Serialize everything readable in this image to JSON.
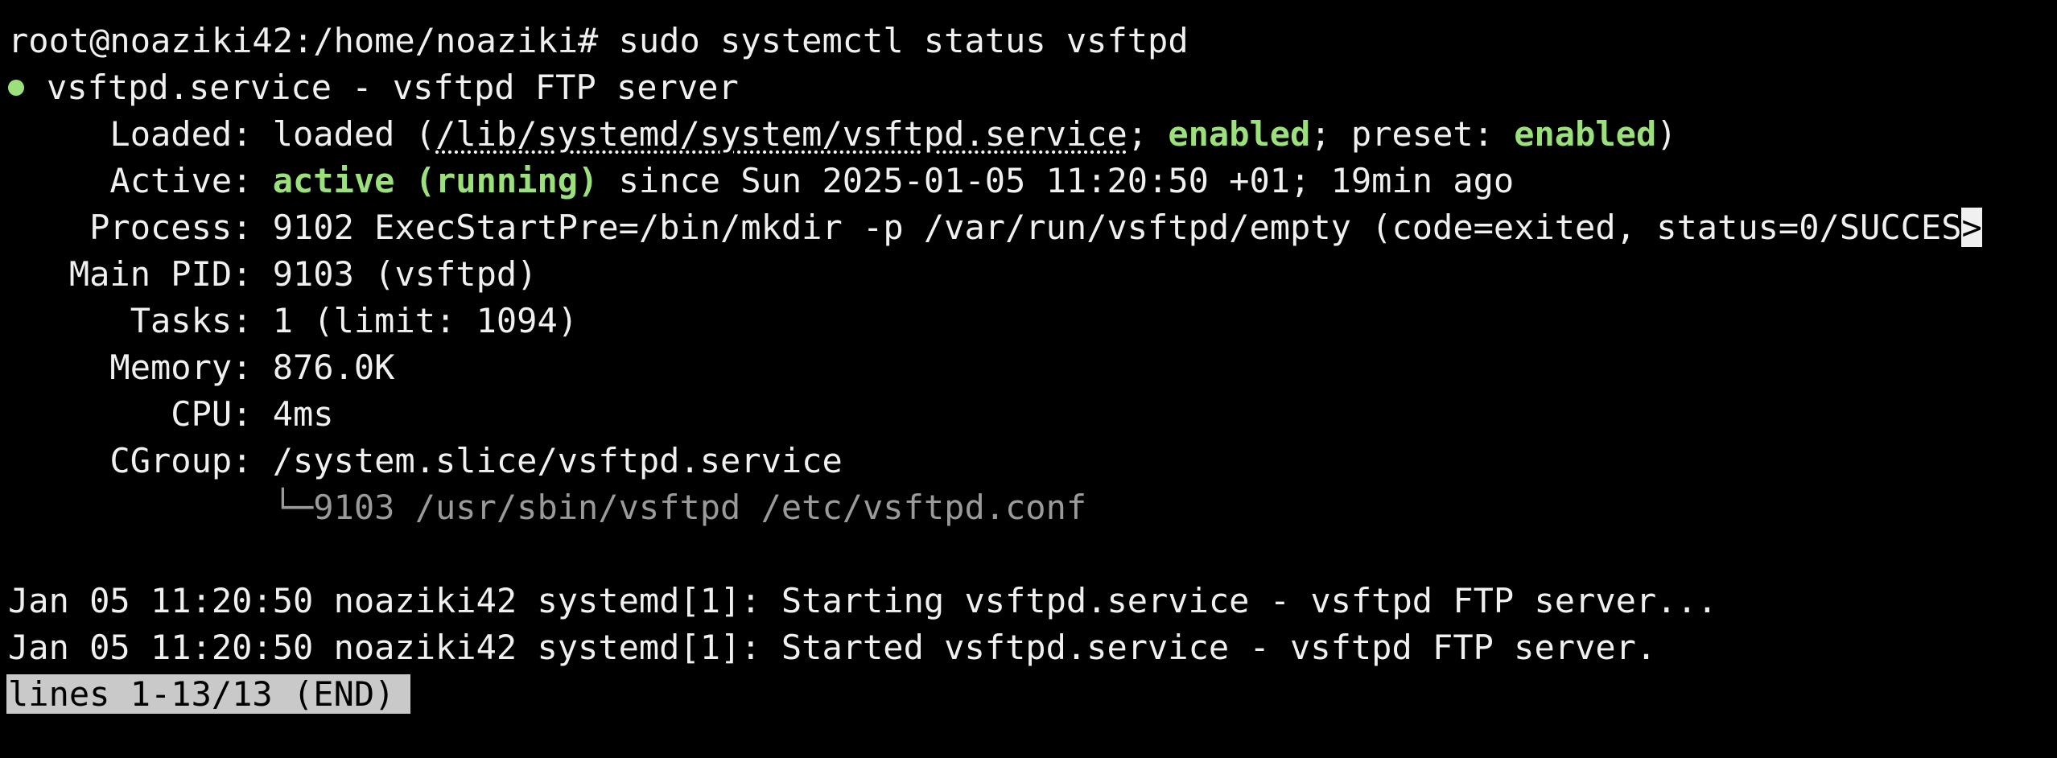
{
  "terminal": {
    "prompt": "root@noaziki42:/home/noaziki# ",
    "command": "sudo systemctl status vsftpd",
    "unit": {
      "name_line": "vsftpd.service - vsftpd FTP server",
      "loaded_label": "     Loaded: ",
      "loaded_pre": "loaded (",
      "loaded_path": "/lib/systemd/system/vsftpd.service",
      "loaded_sep1": "; ",
      "loaded_enabled": "enabled",
      "loaded_sep2": "; preset: ",
      "loaded_preset": "enabled",
      "loaded_post": ")",
      "active_label": "     Active: ",
      "active_state": "active (running)",
      "active_since": " since Sun 2025-01-05 11:20:50 +01; 19min ago",
      "process_label": "    Process: ",
      "process_value": "9102 ExecStartPre=/bin/mkdir -p /var/run/vsftpd/empty (code=exited, status=0/SUCCES",
      "process_trunc": ">",
      "mainpid_label": "   Main PID: ",
      "mainpid_value": "9103 (vsftpd)",
      "tasks_label": "      Tasks: ",
      "tasks_value": "1 (limit: 1094)",
      "memory_label": "     Memory: ",
      "memory_value": "876.0K",
      "cpu_label": "        CPU: ",
      "cpu_value": "4ms",
      "cgroup_label": "     CGroup: ",
      "cgroup_value": "/system.slice/vsftpd.service",
      "cgroup_tree_prefix": "             └─",
      "cgroup_process": "9103 /usr/sbin/vsftpd /etc/vsftpd.conf"
    },
    "log": [
      "Jan 05 11:20:50 noaziki42 systemd[1]: Starting vsftpd.service - vsftpd FTP server...",
      "Jan 05 11:20:50 noaziki42 systemd[1]: Started vsftpd.service - vsftpd FTP server."
    ],
    "pager_status": "lines 1-13/13 (END)"
  },
  "colors": {
    "background": "#000000",
    "foreground": "#f0f0f0",
    "active_green": "#9be07a",
    "dim_gray": "#9a9a9a",
    "pager_bg": "#c9c9c9"
  },
  "icons": {
    "status_dot": "green-status-dot-icon"
  }
}
